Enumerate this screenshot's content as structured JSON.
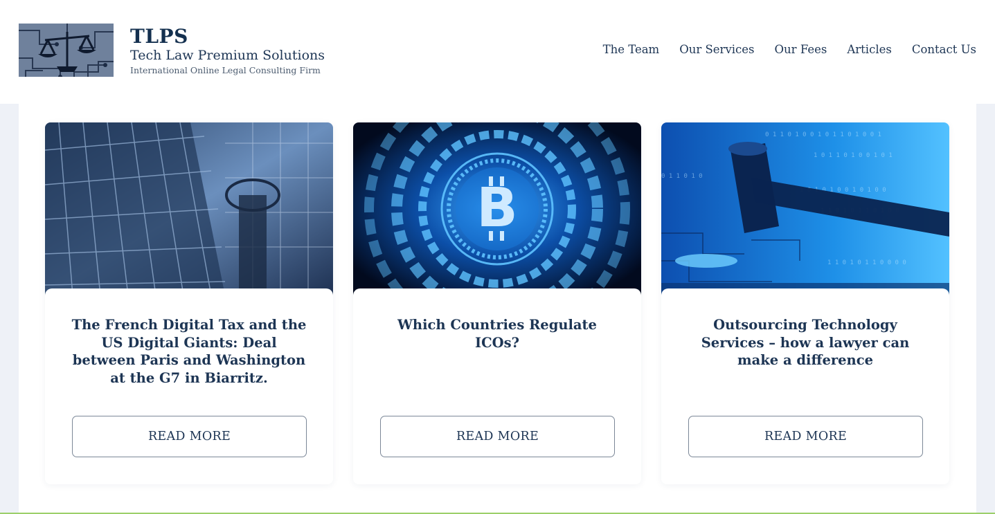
{
  "brand": {
    "abbr": "TLPS",
    "name": "Tech Law Premium Solutions",
    "tagline": "International Online Legal Consulting Firm",
    "logo_icon": "scales-of-justice-circuit-logo"
  },
  "nav": {
    "items": [
      {
        "label": "The Team"
      },
      {
        "label": "Our Services"
      },
      {
        "label": "Our Fees"
      },
      {
        "label": "Articles"
      },
      {
        "label": "Contact Us"
      }
    ]
  },
  "articles": [
    {
      "image": "glass-skyscraper-image",
      "title": "The French Digital Tax and the US Digital Giants: Deal between Paris and Washington at the G7 in Biarritz.",
      "button_label": "READ MORE"
    },
    {
      "image": "bitcoin-circuit-image",
      "title": "Which Countries Regulate ICOs?",
      "button_label": "READ MORE"
    },
    {
      "image": "gavel-binary-image",
      "title": "Outsourcing Technology Services – how a lawyer can make a difference",
      "button_label": "READ MORE"
    }
  ],
  "colors": {
    "navy_text": "#1d3554",
    "page_bg": "#eef1f7",
    "accent_line": "#9ccf6a"
  }
}
